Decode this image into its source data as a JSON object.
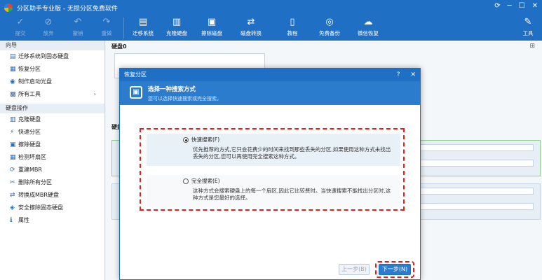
{
  "window": {
    "title": "分区助手专业版 - 无损分区免费软件"
  },
  "toolbar": {
    "items": [
      {
        "label": "提交",
        "icon": "check-icon"
      },
      {
        "label": "放弃",
        "icon": "discard-icon"
      },
      {
        "label": "撤销",
        "icon": "undo-icon"
      },
      {
        "label": "重做",
        "icon": "redo-icon"
      },
      {
        "label": "迁移系统",
        "icon": "migrate-icon"
      },
      {
        "label": "克隆硬盘",
        "icon": "clone-icon"
      },
      {
        "label": "擦除磁盘",
        "icon": "wipe-icon"
      },
      {
        "label": "磁盘转换",
        "icon": "convert-icon"
      },
      {
        "label": "教程",
        "icon": "book-icon"
      },
      {
        "label": "免费备份",
        "icon": "backup-icon"
      },
      {
        "label": "微信恢复",
        "icon": "wechat-icon"
      },
      {
        "label": "工具",
        "icon": "tools-icon"
      }
    ]
  },
  "sidebar": {
    "guide_title": "向导",
    "guide_items": [
      {
        "label": "迁移系统到固态硬盘"
      },
      {
        "label": "恢复分区"
      },
      {
        "label": "制作启动光盘"
      },
      {
        "label": "所有工具"
      }
    ],
    "disk_ops_title": "硬盘操作",
    "disk_items": [
      {
        "label": "克隆硬盘"
      },
      {
        "label": "快速分区"
      },
      {
        "label": "擦除硬盘"
      },
      {
        "label": "检测坏扇区"
      },
      {
        "label": "重建MBR"
      },
      {
        "label": "删除所有分区"
      },
      {
        "label": "转换成MBR硬盘"
      },
      {
        "label": "安全擦除固态硬盘"
      },
      {
        "label": "属性"
      }
    ]
  },
  "main": {
    "disk0_label": "硬盘0",
    "disk1_label": "硬盘"
  },
  "dialog": {
    "title": "恢复分区",
    "help": "?",
    "close": "✕",
    "heading": "选择一种搜索方式",
    "subheading": "您可以选择快速搜索或完全搜索。",
    "options": [
      {
        "label": "快速搜索(F)",
        "desc": "优先推荐的方式,它只会花费少的时间来找到那些丢失的分区,如果使用这种方式未找出丢失的分区,您可以再使用完全搜索这种方式。",
        "selected": true
      },
      {
        "label": "完全搜索(E)",
        "desc": "这种方式会搜索硬盘上的每一个扇区,因此它比较费时。当快速搜索不能找出分区时,这种方式是您最好的选择。",
        "selected": false
      }
    ],
    "prev_label": "上一步(B)",
    "next_label": "下一步(N)"
  }
}
